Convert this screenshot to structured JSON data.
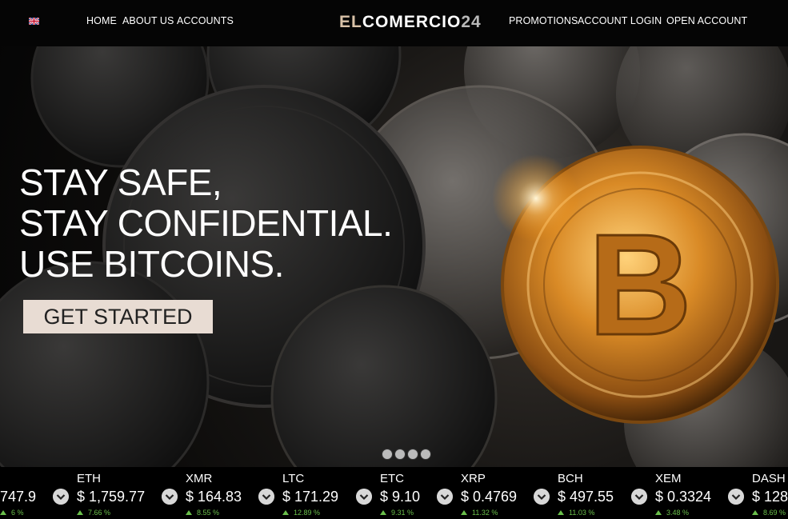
{
  "nav": {
    "language_icon": "uk-flag-icon",
    "left_links": [
      "HOME",
      "ABOUT US",
      "ACCOUNTS"
    ],
    "right_links": [
      "PROMOTIONS",
      "ACCOUNT LOGIN",
      "OPEN ACCOUNT"
    ],
    "logo": {
      "part1": "EL",
      "part2": "COMERCIO",
      "part3": "24"
    }
  },
  "hero": {
    "headline": [
      "STAY SAFE,",
      "STAY CONFIDENTIAL.",
      "USE BITCOINS."
    ],
    "cta_label": "GET STARTED",
    "slides": 4
  },
  "ticker": [
    {
      "symbol": "",
      "price": "747.9",
      "change": "6 %"
    },
    {
      "symbol": "ETH",
      "price": "$ 1,759.77",
      "change": "7.66 %"
    },
    {
      "symbol": "XMR",
      "price": "$ 164.83",
      "change": "8.55 %"
    },
    {
      "symbol": "LTC",
      "price": "$ 171.29",
      "change": "12.89 %"
    },
    {
      "symbol": "ETC",
      "price": "$ 9.10",
      "change": "9.31 %"
    },
    {
      "symbol": "XRP",
      "price": "$ 0.4769",
      "change": "11.32 %"
    },
    {
      "symbol": "BCH",
      "price": "$ 497.55",
      "change": "11.03 %"
    },
    {
      "symbol": "XEM",
      "price": "$ 0.3324",
      "change": "3.48 %"
    },
    {
      "symbol": "DASH",
      "price": "$ 128",
      "change": "8.69 %"
    }
  ],
  "colors": {
    "cta_bg": "#e8dcd3",
    "positive": "#6abf4b",
    "logo_accent": "#d9c2a8"
  }
}
